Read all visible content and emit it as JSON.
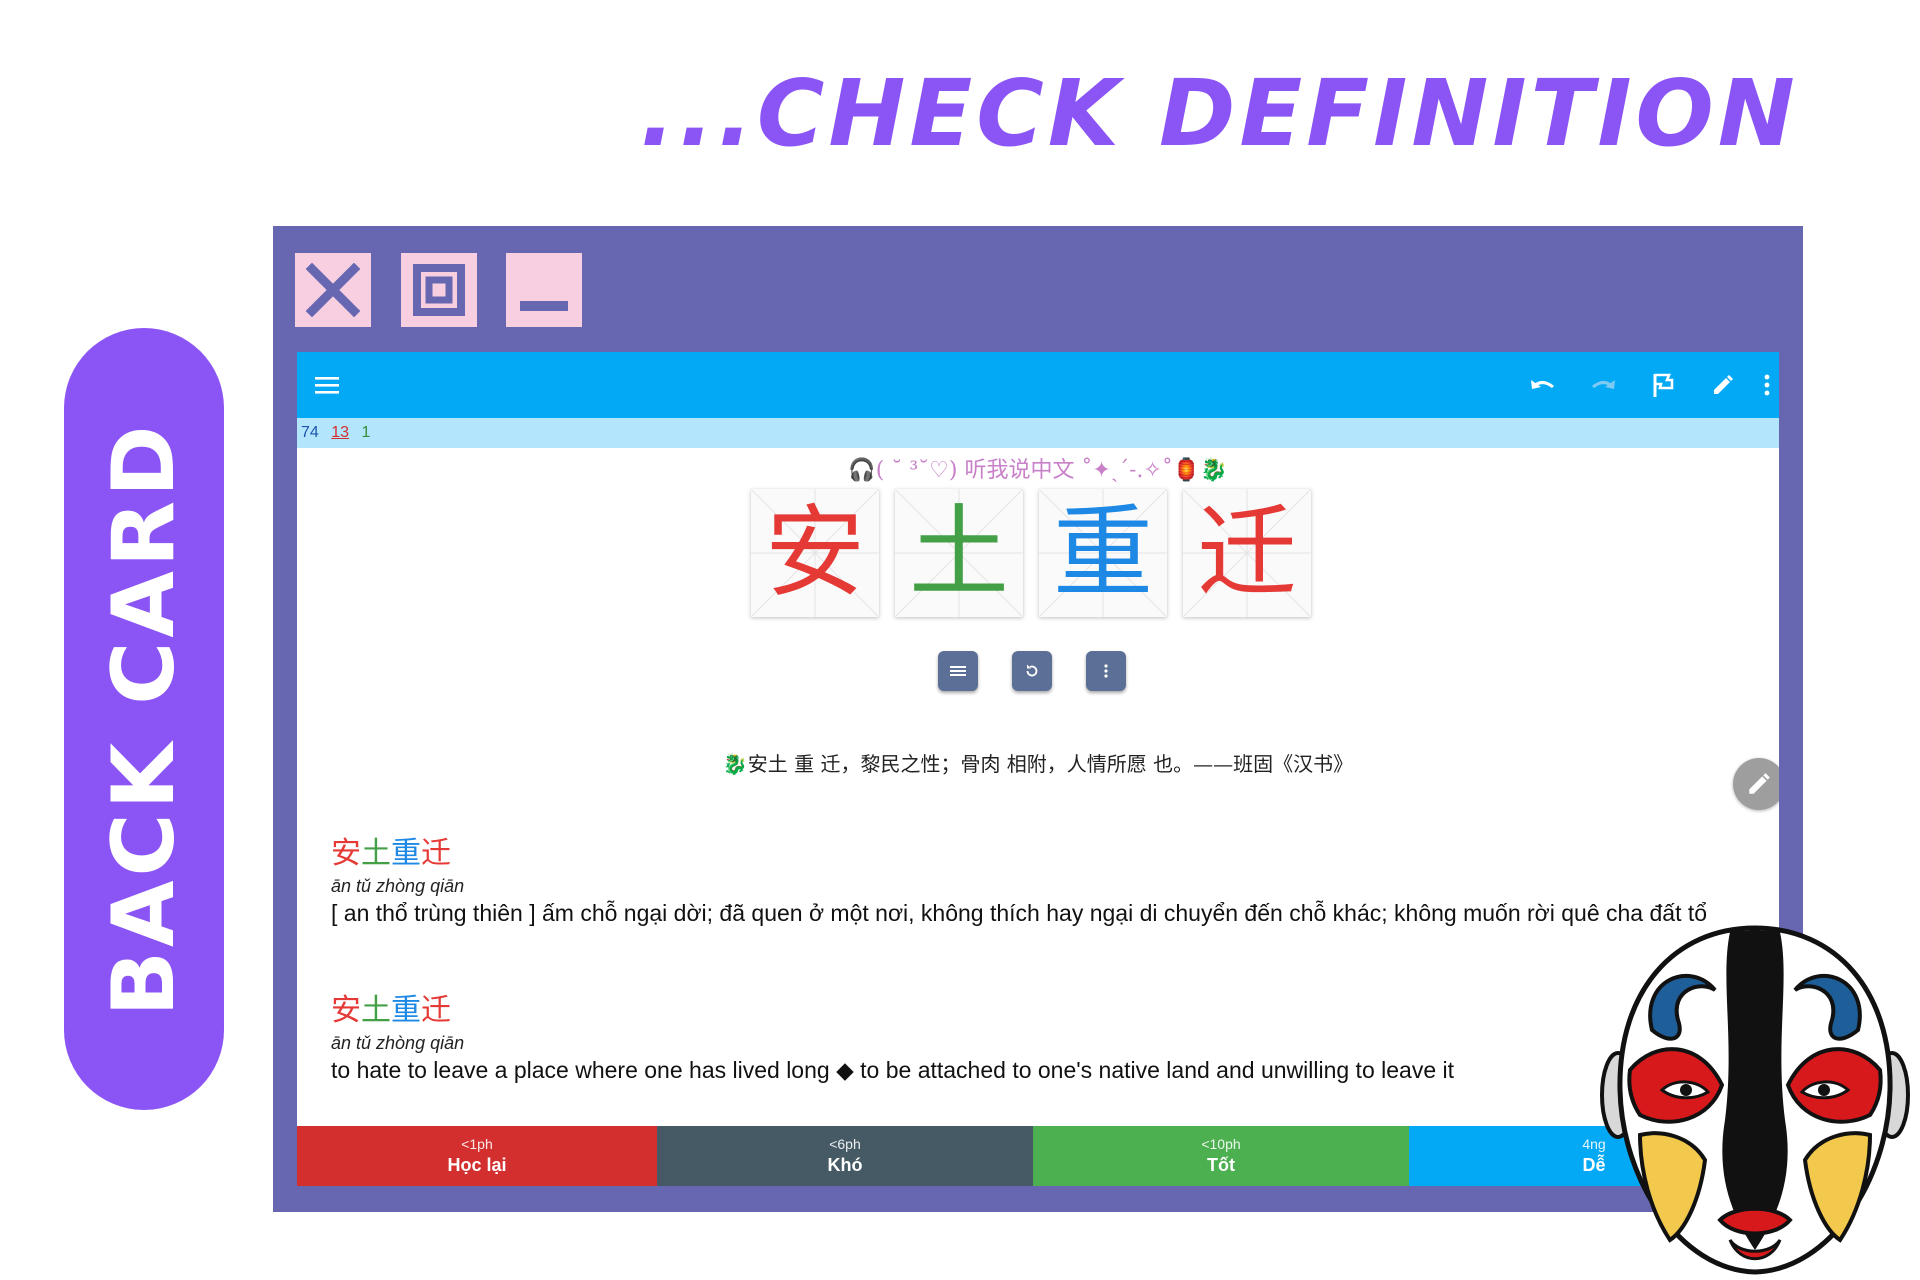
{
  "headline": "...CHECK DEFINITION",
  "side_label": "BACK CARD",
  "window_controls": {
    "close_icon": "close-icon",
    "maximize_icon": "maximize-icon",
    "minimize_icon": "minimize-icon"
  },
  "colors": {
    "accent_purple": "#8b55f5",
    "frame": "#6667b0",
    "toolbar": "#03a9f4",
    "counts_bar": "#b3e5fc"
  },
  "toolbar": {
    "menu_icon": "hamburger-menu-icon",
    "undo_icon": "undo-icon",
    "redo_icon": "redo-icon",
    "flag_icon": "flag-icon",
    "edit_icon": "pencil-icon",
    "more_icon": "more-vertical-icon"
  },
  "counts": {
    "new": "74",
    "learning": "13",
    "review": "1"
  },
  "decoration": "🎧( ˘ ³˘♡) 听我说中文 ˚✦ˎˊ˗.✧˚🏮🐉",
  "hanzi": [
    {
      "char": "安",
      "color": "#e53935"
    },
    {
      "char": "土",
      "color": "#43a047"
    },
    {
      "char": "重",
      "color": "#1e88e5"
    },
    {
      "char": "迁",
      "color": "#e53935"
    }
  ],
  "controls": {
    "list_icon": "list-icon",
    "replay_icon": "replay-icon",
    "more_icon": "more-vertical-icon"
  },
  "quote": "🐉安土 重 迁，黎民之性；骨肉 相附，人情所愿 也。——班固《汉书》",
  "definitions": [
    {
      "chars": [
        "安",
        "土",
        "重",
        "迁"
      ],
      "pinyin": "ān tǔ zhòng qiān",
      "text": "[ an thổ trùng thiên ] ấm chỗ ngại dời; đã quen ở một nơi, không thích hay ngại di chuyển đến chỗ khác; không muốn rời quê cha đất tổ"
    },
    {
      "chars": [
        "安",
        "土",
        "重",
        "迁"
      ],
      "pinyin": "ān tǔ zhòng qiān",
      "text": "to hate to leave a place where one has lived long ◆ to be attached to one's native land and unwilling to leave it"
    }
  ],
  "answers": [
    {
      "time": "<1ph",
      "label": "Học lại",
      "color": "#d32f2f"
    },
    {
      "time": "<6ph",
      "label": "Khó",
      "color": "#455a64"
    },
    {
      "time": "<10ph",
      "label": "Tốt",
      "color": "#4caf50"
    },
    {
      "time": "4ng",
      "label": "Dễ",
      "color": "#03a9f4"
    }
  ],
  "mask_icon": "peking-opera-mask"
}
